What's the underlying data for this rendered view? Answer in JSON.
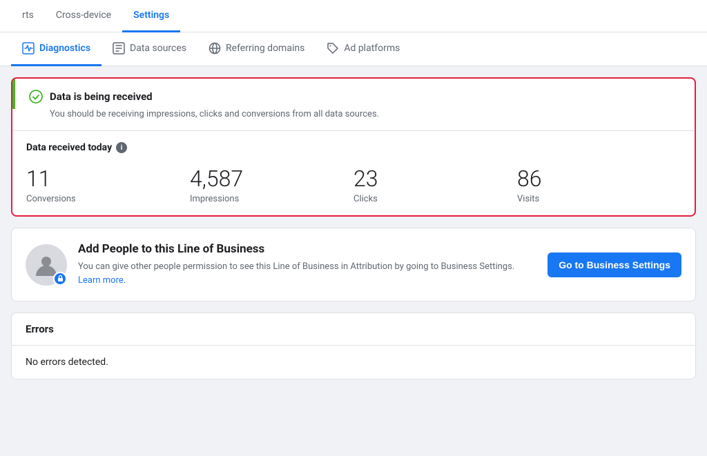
{
  "topNav": {
    "tabs": [
      {
        "id": "rts",
        "label": "rts",
        "active": false
      },
      {
        "id": "cross-device",
        "label": "Cross-device",
        "active": false
      },
      {
        "id": "settings",
        "label": "Settings",
        "active": true
      }
    ]
  },
  "subTabs": {
    "tabs": [
      {
        "id": "diagnostics",
        "label": "Diagnostics",
        "icon": "diagnostics",
        "active": true
      },
      {
        "id": "data-sources",
        "label": "Data sources",
        "icon": "data-sources",
        "active": false
      },
      {
        "id": "referring-domains",
        "label": "Referring domains",
        "icon": "globe",
        "active": false
      },
      {
        "id": "ad-platforms",
        "label": "Ad platforms",
        "icon": "tag",
        "active": false
      }
    ]
  },
  "statusCard": {
    "title": "Data is being received",
    "subtitle": "You should be receiving impressions, clicks and conversions from all data sources."
  },
  "dataReceived": {
    "header": "Data received today",
    "metrics": [
      {
        "id": "conversions",
        "value": "11",
        "label": "Conversions"
      },
      {
        "id": "impressions",
        "value": "4,587",
        "label": "Impressions"
      },
      {
        "id": "clicks",
        "value": "23",
        "label": "Clicks"
      },
      {
        "id": "visits",
        "value": "86",
        "label": "Visits"
      }
    ]
  },
  "addPeople": {
    "title": "Add People to this Line of Business",
    "description": "You can give other people permission to see this Line of Business in Attribution by going to Business Settings.",
    "learnMoreText": "Learn more.",
    "buttonLabel": "Go to Business Settings"
  },
  "errors": {
    "header": "Errors",
    "body": "No errors detected."
  }
}
